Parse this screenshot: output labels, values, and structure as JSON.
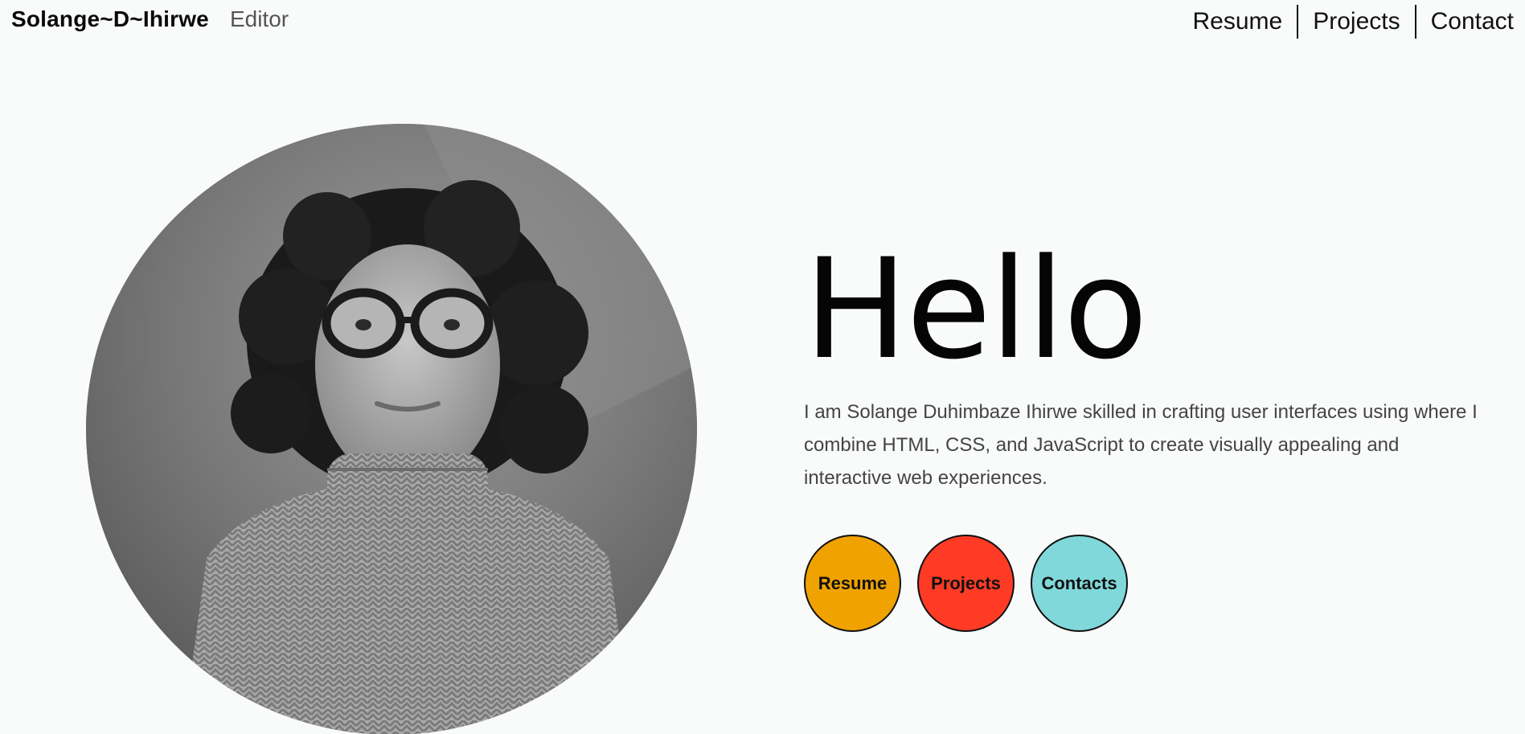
{
  "header": {
    "brand_name": "Solange~D~Ihirwe",
    "brand_role": "Editor",
    "nav": [
      {
        "label": "Resume"
      },
      {
        "label": "Projects"
      },
      {
        "label": "Contact"
      }
    ]
  },
  "hero": {
    "title": "Hello",
    "description": "I am Solange Duhimbaze Ihirwe skilled in crafting user interfaces using where I combine HTML, CSS, and JavaScript to create visually appealing and interactive web experiences.",
    "buttons": [
      {
        "label": "Resume",
        "color": "#f0a200"
      },
      {
        "label": "Projects",
        "color": "#ff3b25"
      },
      {
        "label": "Contacts",
        "color": "#80d8da"
      }
    ]
  },
  "photo": {
    "icon": "portrait-photo"
  }
}
